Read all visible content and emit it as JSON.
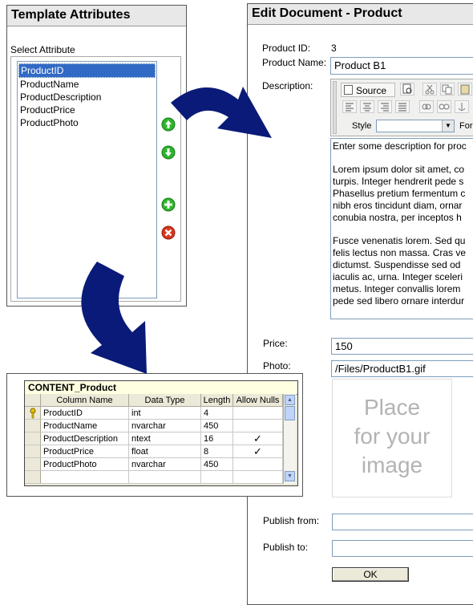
{
  "template_panel": {
    "title": "Template Attributes",
    "select_label": "Select Attribute",
    "attributes": [
      "ProductID",
      "ProductName",
      "ProductDescription",
      "ProductPrice",
      "ProductPhoto"
    ],
    "selected_index": 0
  },
  "edit_panel": {
    "title": "Edit Document - Product",
    "product_id_label": "Product ID:",
    "product_id_value": "3",
    "product_name_label": "Product Name:",
    "product_name_value": "Product B1",
    "description_label": "Description:",
    "toolbar": {
      "source_label": "Source",
      "style_label": "Style",
      "format_label": "Forr"
    },
    "description_lines": [
      [
        "Enter some description for proc"
      ],
      [
        "Lorem ipsum dolor sit amet, co",
        "turpis. Integer hendrerit pede s",
        "Phasellus pretium fermentum c",
        "nibh eros tincidunt diam, ornar",
        "conubia nostra, per inceptos h"
      ],
      [
        "Fusce venenatis lorem. Sed qu",
        "felis lectus non massa. Cras ve",
        "dictumst. Suspendisse sed od",
        "iaculis ac, urna. Integer sceleri",
        "metus. Integer convallis lorem",
        "pede sed libero ornare interdur"
      ]
    ],
    "price_label": "Price:",
    "price_value": "150",
    "photo_label": "Photo:",
    "photo_value": "/Files/ProductB1.gif",
    "placeholder_lines": [
      "Place",
      "for your",
      "image"
    ],
    "publish_from_label": "Publish from:",
    "publish_from_value": "",
    "publish_to_label": "Publish to:",
    "publish_to_value": "",
    "ok_label": "OK"
  },
  "table": {
    "title": "CONTENT_Product",
    "columns": [
      "Column Name",
      "Data Type",
      "Length",
      "Allow Nulls"
    ],
    "rows": [
      {
        "name": "ProductID",
        "type": "int",
        "length": "4",
        "nulls": "",
        "key": true
      },
      {
        "name": "ProductName",
        "type": "nvarchar",
        "length": "450",
        "nulls": ""
      },
      {
        "name": "ProductDescription",
        "type": "ntext",
        "length": "16",
        "nulls": "✓"
      },
      {
        "name": "ProductPrice",
        "type": "float",
        "length": "8",
        "nulls": "✓"
      },
      {
        "name": "ProductPhoto",
        "type": "nvarchar",
        "length": "450",
        "nulls": ""
      }
    ]
  },
  "colors": {
    "arrow": "#0a1a78",
    "selection": "#316ac5",
    "up_down_buttons": "#2db52d",
    "remove_button": "#d9361b"
  },
  "icons": [
    "arrow-up-icon",
    "arrow-down-icon",
    "plus-icon",
    "delete-icon",
    "key-icon",
    "checkmark-icon",
    "curved-arrow-icon"
  ]
}
